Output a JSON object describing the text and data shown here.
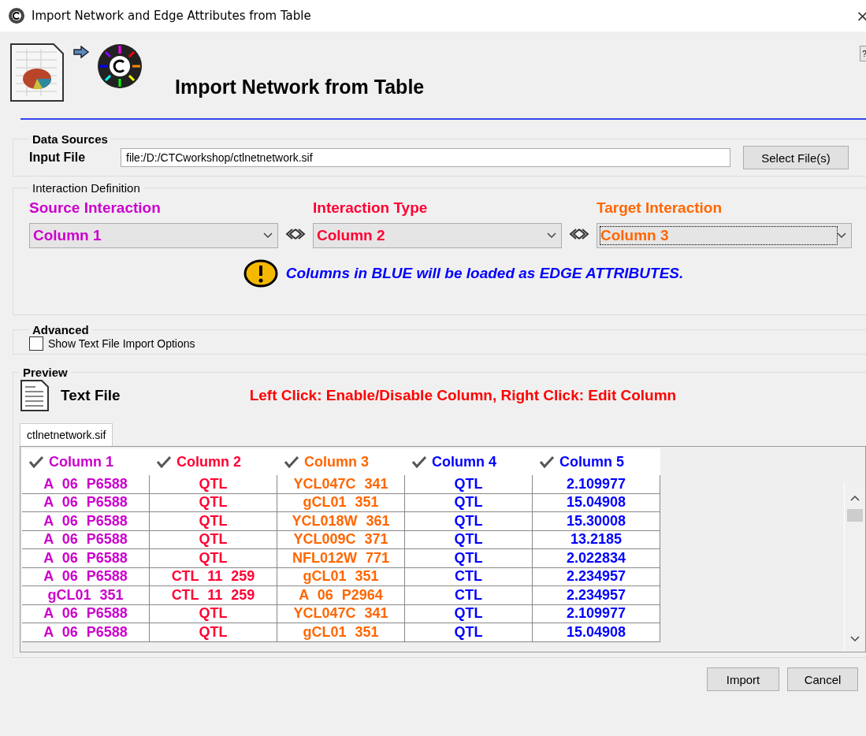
{
  "window": {
    "title": "Import Network and Edge Attributes from Table",
    "close": "×"
  },
  "header": {
    "help": "?",
    "title": "Import Network from Table"
  },
  "data_sources": {
    "legend": "Data Sources",
    "label": "Input File",
    "value": "file:/D:/CTCworkshop/ctlnetnetwork.sif",
    "button": "Select File(s)"
  },
  "interaction": {
    "legend": "Interaction Definition",
    "selectors": [
      {
        "label": "Source Interaction",
        "value": "Column 1",
        "color": "#cc00cc",
        "focused": false
      },
      {
        "label": "Interaction Type",
        "value": "Column 2",
        "color": "#ff0033",
        "focused": false
      },
      {
        "label": "Target Interaction",
        "value": "Column 3",
        "color": "#ff6600",
        "focused": true
      }
    ],
    "note": "Columns in BLUE will be loaded as EDGE ATTRIBUTES."
  },
  "advanced": {
    "legend": "Advanced",
    "option": {
      "label": "Show Text File Import Options",
      "checked": false
    }
  },
  "preview": {
    "legend": "Preview",
    "file_label": "Text File",
    "hint": "Left Click: Enable/Disable Column, Right Click: Edit Column",
    "tabs": [
      {
        "label": "ctlnetnetwork.sif",
        "selected": true
      }
    ],
    "table": {
      "columns": [
        {
          "label": "Column 1",
          "color": "#cc00cc",
          "enabled": true
        },
        {
          "label": "Column 2",
          "color": "#ff0033",
          "enabled": true
        },
        {
          "label": "Column 3",
          "color": "#ff6600",
          "enabled": true
        },
        {
          "label": "Column 4",
          "color": "#0000ff",
          "enabled": true
        },
        {
          "label": "Column 5",
          "color": "#0000ff",
          "enabled": true
        }
      ],
      "rows": [
        [
          "A 06 P6588",
          "QTL",
          "YCL047C 341",
          "QTL",
          "2.109977"
        ],
        [
          "A 06 P6588",
          "QTL",
          "gCL01 351",
          "QTL",
          "15.04908"
        ],
        [
          "A 06 P6588",
          "QTL",
          "YCL018W 361",
          "QTL",
          "15.30008"
        ],
        [
          "A 06 P6588",
          "QTL",
          "YCL009C 371",
          "QTL",
          "13.2185"
        ],
        [
          "A 06 P6588",
          "QTL",
          "NFL012W 771",
          "QTL",
          "2.022834"
        ],
        [
          "A 06 P6588",
          "CTL 11 259",
          "gCL01 351",
          "CTL",
          "2.234957"
        ],
        [
          "gCL01 351",
          "CTL 11 259",
          "A 06 P2964",
          "CTL",
          "2.234957"
        ],
        [
          "A 06 P6588",
          "QTL",
          "YCL047C 341",
          "QTL",
          "2.109977"
        ],
        [
          "A 06 P6588",
          "QTL",
          "gCL01 351",
          "QTL",
          "15.04908"
        ]
      ]
    }
  },
  "buttons": [
    "Import",
    "Cancel"
  ]
}
